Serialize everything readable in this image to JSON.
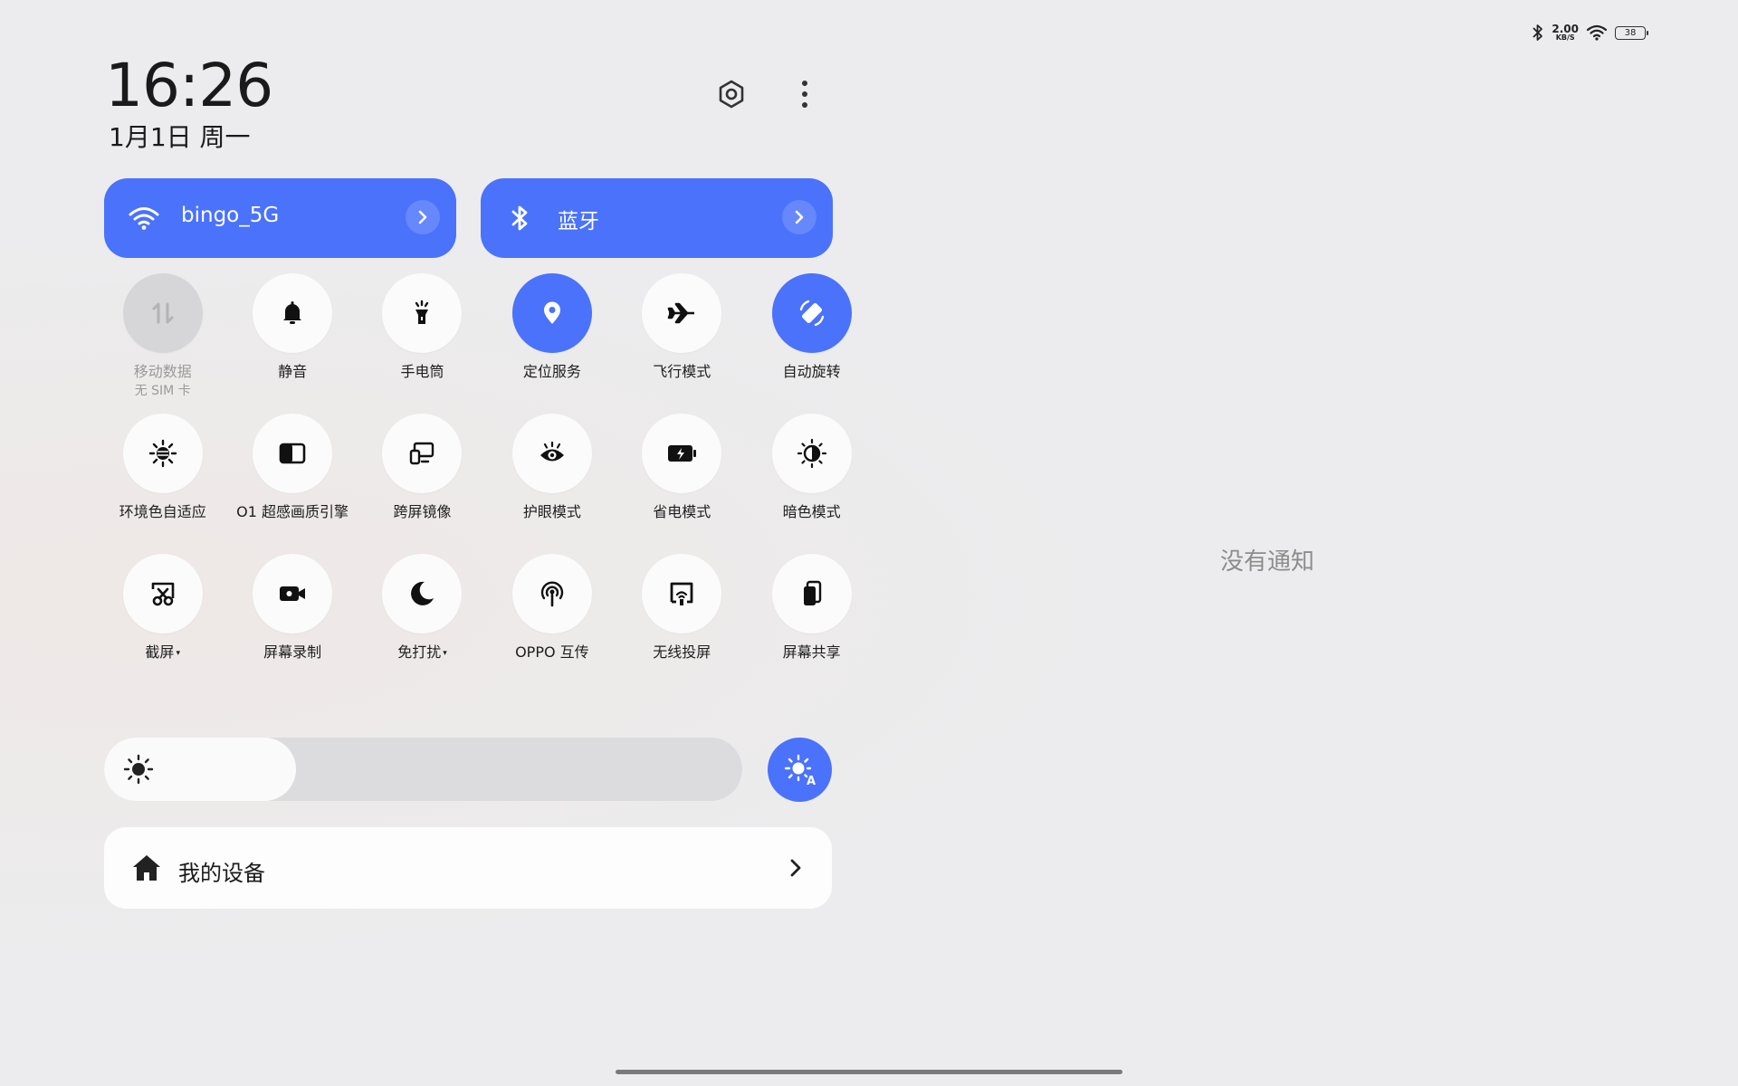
{
  "status_bar": {
    "net_speed_value": "2.00",
    "net_speed_unit": "KB/S",
    "battery": "38"
  },
  "header": {
    "time": "16:26",
    "date": "1月1日 周一"
  },
  "big_tiles": {
    "wifi_label": "bingo_5G",
    "bluetooth_label": "蓝牙"
  },
  "toggles": [
    {
      "label": "移动数据",
      "sub": "无 SIM 卡",
      "icon": "mobile-data-icon",
      "state": "disabled"
    },
    {
      "label": "静音",
      "icon": "bell-icon",
      "state": "off"
    },
    {
      "label": "手电筒",
      "icon": "flashlight-icon",
      "state": "off"
    },
    {
      "label": "定位服务",
      "icon": "location-icon",
      "state": "on"
    },
    {
      "label": "飞行模式",
      "icon": "airplane-icon",
      "state": "off"
    },
    {
      "label": "自动旋转",
      "icon": "auto-rotate-icon",
      "state": "on"
    },
    {
      "label": "环境色自适应",
      "icon": "ambient-color-icon",
      "state": "off"
    },
    {
      "label": "O1 超感画质引擎",
      "icon": "display-engine-icon",
      "state": "off"
    },
    {
      "label": "跨屏镜像",
      "icon": "screen-mirror-icon",
      "state": "off"
    },
    {
      "label": "护眼模式",
      "icon": "eye-icon",
      "state": "off"
    },
    {
      "label": "省电模式",
      "icon": "battery-saver-icon",
      "state": "off"
    },
    {
      "label": "暗色模式",
      "icon": "dark-mode-icon",
      "state": "off"
    },
    {
      "label": "截屏",
      "icon": "screenshot-icon",
      "state": "off",
      "caret": "▾"
    },
    {
      "label": "屏幕录制",
      "icon": "screen-record-icon",
      "state": "off"
    },
    {
      "label": "免打扰",
      "icon": "moon-icon",
      "state": "off",
      "caret": "▾"
    },
    {
      "label": "OPPO 互传",
      "icon": "share-icon",
      "state": "off"
    },
    {
      "label": "无线投屏",
      "icon": "cast-icon",
      "state": "off"
    },
    {
      "label": "屏幕共享",
      "icon": "screen-share-icon",
      "state": "off"
    }
  ],
  "brightness": {
    "level": 0.3
  },
  "devices": {
    "label": "我的设备"
  },
  "notifications": {
    "empty_text": "没有通知"
  },
  "colors": {
    "accent": "#4a72fb",
    "tile_bg": "#fbfbfb",
    "background": "#ececee"
  }
}
